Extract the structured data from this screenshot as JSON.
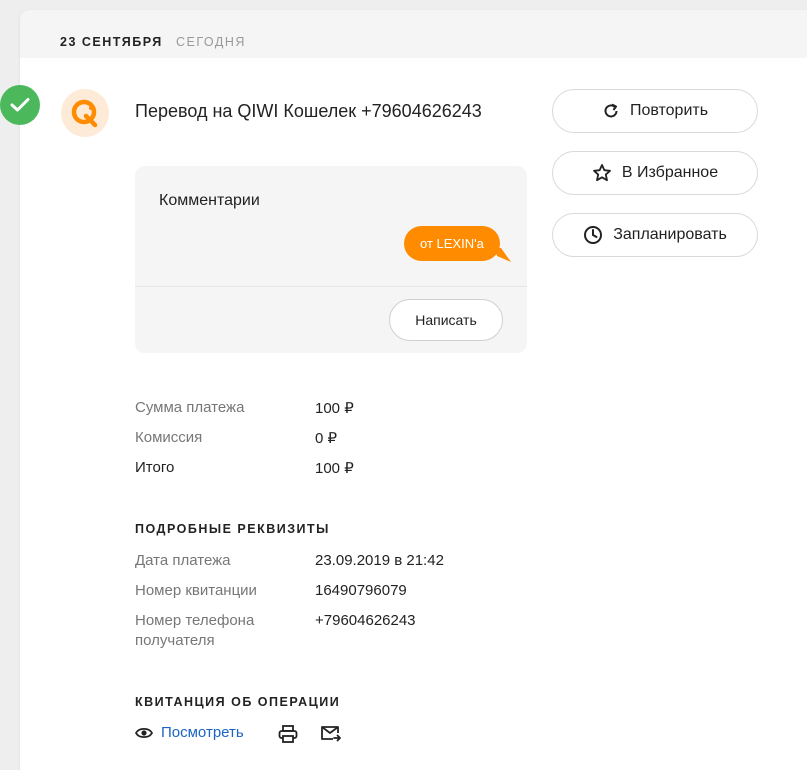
{
  "date": {
    "main": "23 СЕНТЯБРЯ",
    "sub": "СЕГОДНЯ"
  },
  "transaction": {
    "title": "Перевод на QIWI Кошелек +79604626243",
    "status_icon": "check-icon",
    "provider_icon": "qiwi-logo"
  },
  "actions": {
    "repeat": "Повторить",
    "favorite": "В Избранное",
    "schedule": "Запланировать"
  },
  "comments": {
    "title": "Комментарии",
    "message": "от LEXIN'a",
    "write_label": "Написать"
  },
  "summary": [
    {
      "label": "Сумма платежа",
      "value": "100 ₽"
    },
    {
      "label": "Комиссия",
      "value": "0 ₽"
    },
    {
      "label": "Итого",
      "value": "100 ₽"
    }
  ],
  "details": {
    "title": "ПОДРОБНЫЕ РЕКВИЗИТЫ",
    "rows": [
      {
        "label": "Дата платежа",
        "value": "23.09.2019 в 21:42"
      },
      {
        "label": "Номер квитанции",
        "value": "16490796079"
      },
      {
        "label_line1": "Номер телефона",
        "label_line2": "получателя",
        "value": "+79604626243"
      }
    ]
  },
  "receipt": {
    "title": "КВИТАНЦИЯ ОБ ОПЕРАЦИИ",
    "view_label": "Посмотреть"
  },
  "colors": {
    "accent": "#ff8c00",
    "success": "#4cb85c",
    "link": "#1b63c6"
  }
}
